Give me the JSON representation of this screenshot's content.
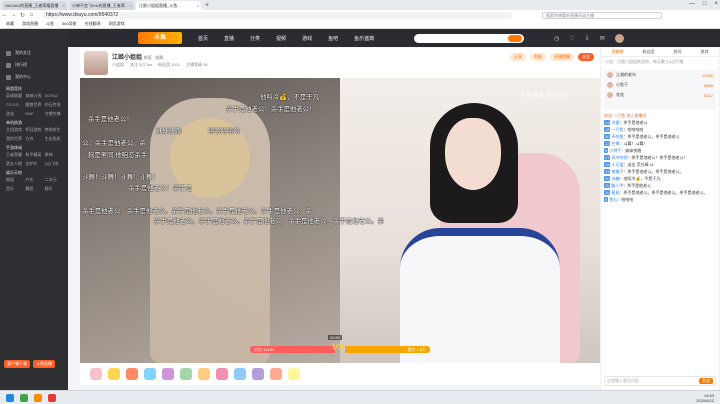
{
  "browser": {
    "tabs": [
      {
        "title": "NAGAKI的直播_王者荣耀直播"
      },
      {
        "title": "小神不会飞Wiz的直播_王者荣..."
      },
      {
        "title": "江姬小姐姐直播_斗鱼...",
        "active": true
      }
    ],
    "url": "https://www.douyu.com/9540372",
    "search_placeholder": "搜索你想要的直播间或主播",
    "bookmarks": [
      "收藏",
      "游戏直播",
      "斗鱼",
      "360导航",
      "在线翻译",
      "网页游戏"
    ]
  },
  "site": {
    "logo": "斗鱼",
    "nav": [
      "首页",
      "直播",
      "分类",
      "视频",
      "游戏",
      "鱼吧",
      "鱼乐盛典"
    ],
    "sidebar_top": [
      "我的关注",
      "排行榜",
      "我的中心"
    ],
    "sidebar_sections": [
      {
        "title": "网游竞技",
        "items": [
          "英雄联盟",
          "穿越火线",
          "DOTA2",
          "CS:GO",
          "魔兽世界",
          "炉石传说",
          "逆战",
          "DNF",
          "守望先锋"
        ]
      },
      {
        "title": "单机热游",
        "items": [
          "主机游戏",
          "怀旧游戏",
          "绝地求生",
          "我的世界",
          "方舟",
          "生化危机"
        ]
      },
      {
        "title": "手游休闲",
        "items": [
          "王者荣耀",
          "和平精英",
          "原神",
          "第五人格",
          "金铲铲",
          "QQ飞车"
        ]
      },
      {
        "title": "娱乐天地",
        "items": [
          "颜值",
          "户外",
          "二次元",
          "音乐",
          "舞蹈",
          "聊天"
        ]
      }
    ],
    "sidebar_buttons": [
      "客户端下载",
      "斗鱼直播"
    ]
  },
  "room": {
    "anchor_name": "江姬小姐姐",
    "category": "颜值 · 跳舞",
    "meta": [
      "小姐姐",
      "关注 527.5w",
      "粉丝团 1001",
      "主播等级 28"
    ],
    "pills": [
      "分享",
      "举报",
      "开播提醒",
      "关注"
    ]
  },
  "video": {
    "watermark": "斗鱼直播 9540372",
    "danmu": [
      "他叫冷💰，不是于凡",
      "杀手是他老公！杀手是他老公！",
      "杀手是他老公！",
      "妹妹快跑",
      "哈哈哈哈哈",
      "公。杀手是他老公。杀",
      "狗是男同 他咱恋杀手",
      "斗舞！斗舞！斗舞！斗舞！",
      "杀手是他老公！杀手是",
      "杀手是他老公。杀手是他老公。杀手是他老公。杀手是他老公。杀手是他老公。杀",
      "杀手是他老公。杀手是他老公。杀手是他老公。杀手是他老公。杀手是他老公。杀"
    ],
    "pk": {
      "timer": "03:50",
      "left_label": "对方 12194",
      "right_label": "我方 1.8万",
      "vs": "VS"
    }
  },
  "chat": {
    "tabs": [
      "贡献榜",
      "粉丝团",
      "房间",
      "贵宾"
    ],
    "notice": "公告：江姬小姐姐欢迎你，每天晚上8点开播",
    "ranks": [
      {
        "name": "江湖的老鸟",
        "score": "12940"
      },
      {
        "name": "小鱼干",
        "score": "8855"
      },
      {
        "name": "花花",
        "score": "6312"
      }
    ],
    "messages": [
      {
        "level": "24",
        "name": "冷星",
        "text": "杀手是他老公"
      },
      {
        "level": "18",
        "name": "一只鱼",
        "text": "哈哈哈哈"
      },
      {
        "level": "30",
        "name": "不吃鱼",
        "text": "杀手是他老公，杀手是他老公"
      },
      {
        "level": "12",
        "name": "芒果",
        "text": "斗舞！斗舞！"
      },
      {
        "level": "9",
        "name": "小饼干",
        "text": "妹妹快跑"
      },
      {
        "level": "27",
        "name": "风中的你",
        "text": "杀手是他老公！杀手是他老公！"
      },
      {
        "level": "15",
        "name": "小可爱",
        "text": "送出 荧光棒 x1"
      },
      {
        "level": "33",
        "name": "夜猫子",
        "text": "杀手是他老公。杀手是他老公。"
      },
      {
        "level": "20",
        "name": "冰糖",
        "text": "他叫冷💰，不是于凡"
      },
      {
        "level": "11",
        "name": "路人甲",
        "text": "杀手是他老公"
      },
      {
        "level": "26",
        "name": "星辰",
        "text": "杀手是他老公。杀手是他老公。杀手是他老公。"
      },
      {
        "level": "8",
        "name": "鱼丸",
        "text": "哈哈哈"
      }
    ],
    "system_msg": "欢迎 一只鱼 进入直播间",
    "input_placeholder": "这里输入聊天内容",
    "send_label": "发送"
  },
  "taskbar": {
    "time": "15:53",
    "date": "2020/6/22"
  },
  "colors": {
    "accent": "#ff7a00",
    "pk_left": "#ff5c5c",
    "pk_right": "#f7a600"
  }
}
